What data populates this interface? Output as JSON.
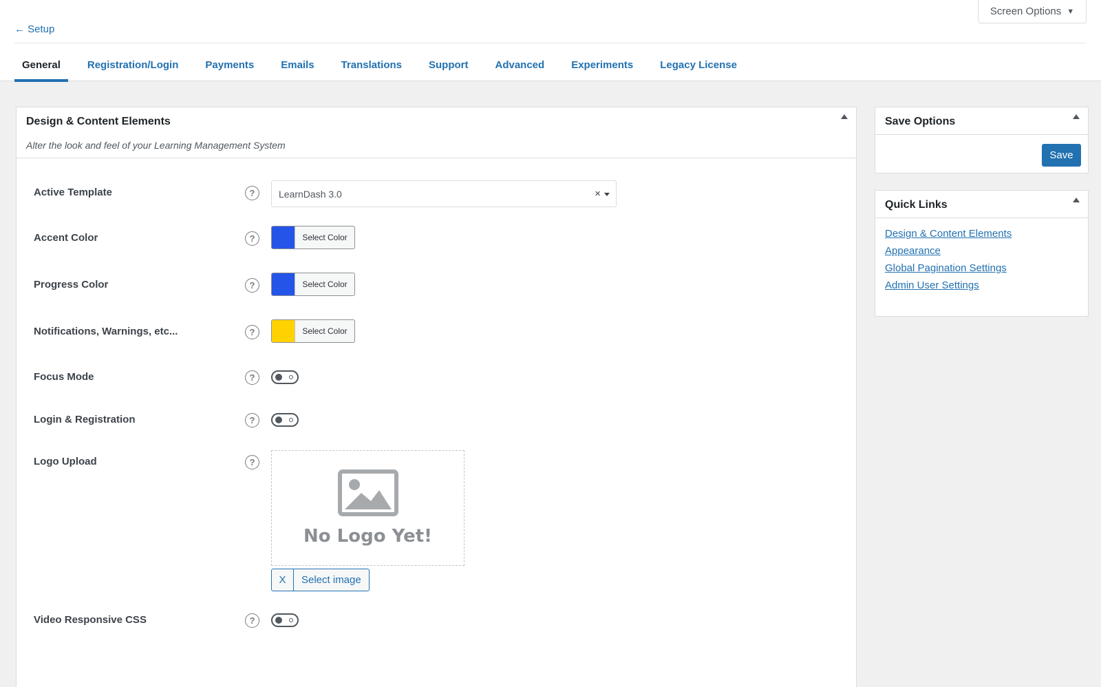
{
  "top": {
    "back_link": "← Setup",
    "screen_options": "Screen Options"
  },
  "tabs": [
    {
      "label": "General",
      "active": true
    },
    {
      "label": "Registration/Login"
    },
    {
      "label": "Payments"
    },
    {
      "label": "Emails"
    },
    {
      "label": "Translations"
    },
    {
      "label": "Support"
    },
    {
      "label": "Advanced"
    },
    {
      "label": "Experiments"
    },
    {
      "label": "Legacy License"
    }
  ],
  "main": {
    "title": "Design & Content Elements",
    "subtitle": "Alter the look and feel of your Learning Management System",
    "help_glyph": "?",
    "active_template": {
      "label": "Active Template",
      "value": "LearnDash 3.0",
      "clear": "×"
    },
    "accent_color": {
      "label": "Accent Color",
      "button": "Select Color",
      "color": "#2454e8"
    },
    "progress_color": {
      "label": "Progress Color",
      "button": "Select Color",
      "color": "#2454e8"
    },
    "notifications_color": {
      "label": "Notifications, Warnings, etc...",
      "button": "Select Color",
      "color": "#ffd200"
    },
    "focus_mode": {
      "label": "Focus Mode",
      "enabled": false
    },
    "login_registration": {
      "label": "Login & Registration",
      "enabled": false
    },
    "logo_upload": {
      "label": "Logo Upload",
      "placeholder_text": "No Logo Yet!",
      "remove_button": "X",
      "select_button": "Select image"
    },
    "video_responsive": {
      "label": "Video Responsive CSS",
      "enabled": false
    }
  },
  "save_panel": {
    "title": "Save Options",
    "save_button": "Save"
  },
  "quick_links": {
    "title": "Quick Links",
    "links": [
      "Design & Content Elements",
      "Appearance",
      "Global Pagination Settings",
      "Admin User Settings"
    ]
  },
  "colors": {
    "accent": "#2271b1",
    "blue_swatch": "#2454e8",
    "yellow_swatch": "#ffd200"
  }
}
